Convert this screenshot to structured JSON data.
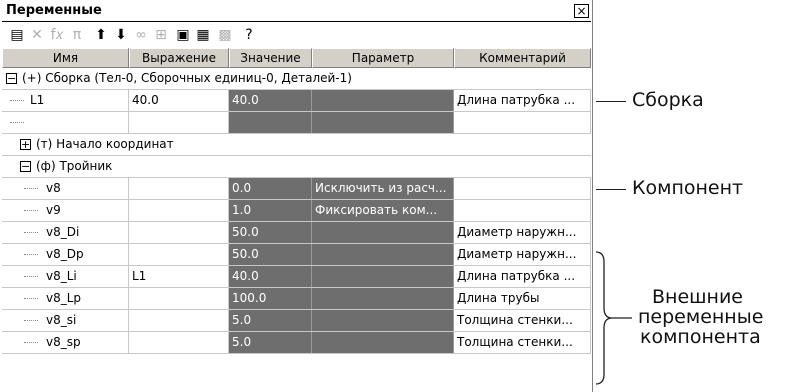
{
  "window": {
    "title": "Переменные",
    "close_glyph": "×"
  },
  "toolbar": {
    "buttons": [
      {
        "icon": "new-variable-icon",
        "glyph": "▤",
        "disabled": false
      },
      {
        "icon": "delete-icon",
        "glyph": "✕",
        "disabled": true
      },
      {
        "icon": "function-icon",
        "glyph": "f𝑥",
        "disabled": true
      },
      {
        "icon": "pi-icon",
        "glyph": "π",
        "disabled": true
      },
      {
        "icon": "arrow-up-icon",
        "glyph": "⬆",
        "disabled": false
      },
      {
        "icon": "arrow-down-icon",
        "glyph": "⬇",
        "disabled": false
      },
      {
        "icon": "link-icon",
        "glyph": "∞",
        "disabled": true
      },
      {
        "icon": "parameter-icon",
        "glyph": "⊞",
        "disabled": true
      },
      {
        "icon": "calculator-icon",
        "glyph": "▣",
        "disabled": false
      },
      {
        "icon": "table-icon",
        "glyph": "▦",
        "disabled": false
      },
      {
        "icon": "grid-icon",
        "glyph": "▩",
        "disabled": true
      },
      {
        "icon": "help-icon",
        "glyph": "?",
        "disabled": false
      }
    ]
  },
  "columns": [
    "Имя",
    "Выражение",
    "Значение",
    "Параметр",
    "Комментарий"
  ],
  "rows": [
    {
      "type": "group",
      "toggle": "−",
      "text": "(+) Сборка (Тел-0, Сборочных единиц-0, Деталей-1)"
    },
    {
      "type": "var",
      "name": "L1",
      "expression": "40.0",
      "value": "40.0",
      "parameter": "",
      "comment": "Длина патрубка ..."
    },
    {
      "type": "var",
      "name": "",
      "expression": "",
      "value": "",
      "parameter": "",
      "comment": ""
    },
    {
      "type": "group",
      "toggle": "+",
      "text": "(т) Начало координат"
    },
    {
      "type": "group",
      "toggle": "−",
      "text": "(ф) Тройник"
    },
    {
      "type": "var",
      "name": "v8",
      "expression": "",
      "value": "0.0",
      "parameter": "Исключить из расч...",
      "comment": ""
    },
    {
      "type": "var",
      "name": "v9",
      "expression": "",
      "value": "1.0",
      "parameter": "Фиксировать ком...",
      "comment": ""
    },
    {
      "type": "var",
      "name": "v8_Di",
      "expression": "",
      "value": "50.0",
      "parameter": "",
      "comment": "Диаметр наружн..."
    },
    {
      "type": "var",
      "name": "v8_Dp",
      "expression": "",
      "value": "50.0",
      "parameter": "",
      "comment": "Диаметр наружн..."
    },
    {
      "type": "var",
      "name": "v8_Li",
      "expression": "L1",
      "value": "40.0",
      "parameter": "",
      "comment": "Длина патрубка ..."
    },
    {
      "type": "var",
      "name": "v8_Lp",
      "expression": "",
      "value": "100.0",
      "parameter": "",
      "comment": "Длина трубы"
    },
    {
      "type": "var",
      "name": "v8_si",
      "expression": "",
      "value": "5.0",
      "parameter": "",
      "comment": "Толщина стенки..."
    },
    {
      "type": "var",
      "name": "v8_sp",
      "expression": "",
      "value": "5.0",
      "parameter": "",
      "comment": "Толщина стенки..."
    }
  ],
  "annotations": {
    "assembly": "Сборка",
    "component": "Компонент",
    "external_line1": "Внешние",
    "external_line2": "переменные",
    "external_line3": "компонента"
  },
  "colors": {
    "value_cell_bg": "#6e6e6e",
    "header_bg": "#d4d0c8"
  }
}
